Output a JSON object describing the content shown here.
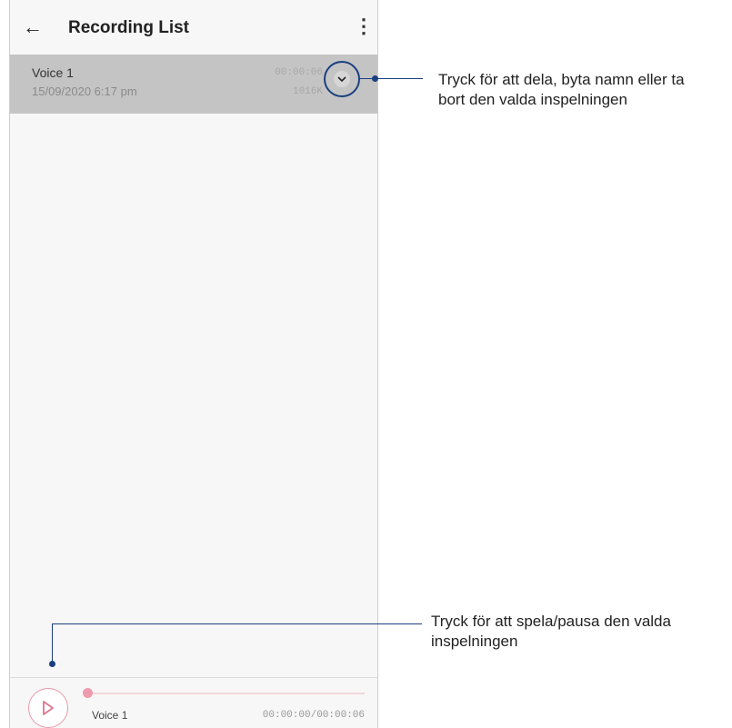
{
  "appbar": {
    "back_icon": "arrow-left-icon",
    "title": "Recording List",
    "menu_icon": "more-vert-icon"
  },
  "recording": {
    "name": "Voice 1",
    "date": "15/09/2020 6:17 pm",
    "duration": "00:00:06",
    "size": "1016K",
    "expand_icon": "chevron-down-icon"
  },
  "player": {
    "play_icon": "play-icon",
    "name": "Voice 1",
    "time": "00:00:00/00:00:06",
    "progress": 0
  },
  "callouts": {
    "expand_text_line1": "Tryck för att dela, byta namn eller ta",
    "expand_text_line2": "bort den valda inspelningen",
    "play_text_line1": "Tryck för att spela/pausa den valda",
    "play_text_line2": "inspelningen"
  },
  "colors": {
    "accent_pink": "#ee9bad",
    "callout_blue": "#1a3f7f",
    "selected_row": "#c4c4c4"
  }
}
